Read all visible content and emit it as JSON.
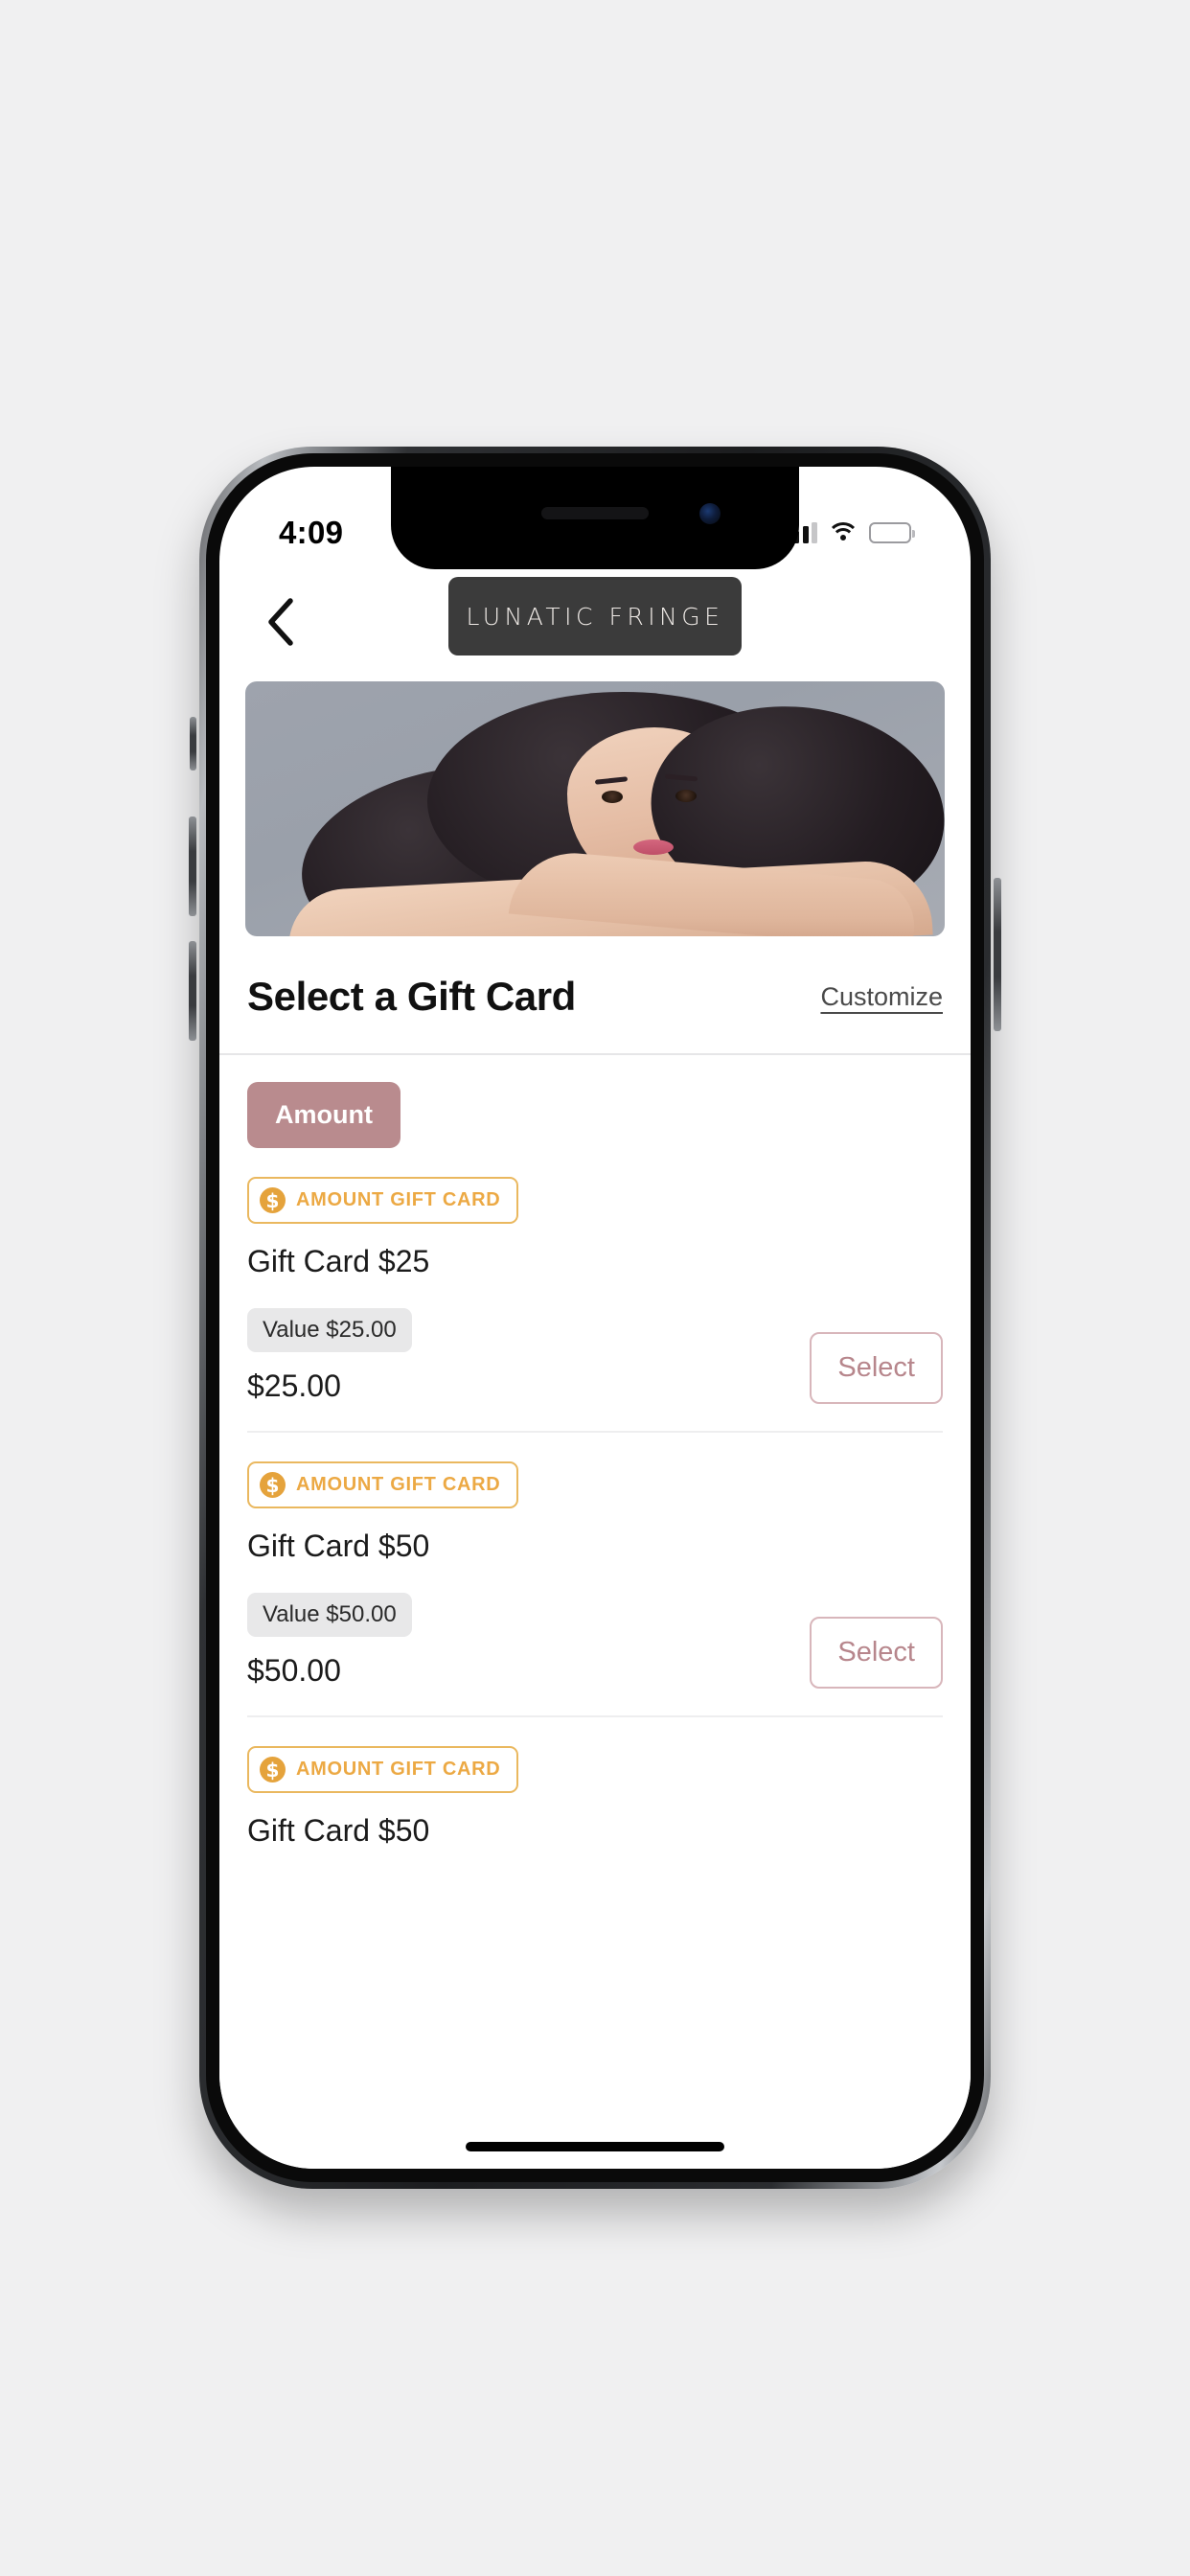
{
  "status_bar": {
    "time": "4:09",
    "signal_icon": "signal-bars-icon",
    "wifi_icon": "wifi-icon",
    "battery_icon": "battery-icon",
    "battery_color": "#ffcc00"
  },
  "header": {
    "back_icon": "chevron-left-icon",
    "brand": "LUNATIC FRINGE"
  },
  "hero": {
    "alt": "woman with long dark wavy hair salon hero image"
  },
  "section": {
    "title": "Select a Gift Card",
    "customize_label": "Customize"
  },
  "filters": {
    "amount_label": "Amount",
    "amount_color": "#b98b8e"
  },
  "gift_cards": [
    {
      "badge": "AMOUNT GIFT CARD",
      "badge_icon": "dollar-circle-icon",
      "name": "Gift Card $25",
      "value_label": "Value $25.00",
      "price": "$25.00",
      "select_label": "Select"
    },
    {
      "badge": "AMOUNT GIFT CARD",
      "badge_icon": "dollar-circle-icon",
      "name": "Gift Card $50",
      "value_label": "Value $50.00",
      "price": "$50.00",
      "select_label": "Select"
    },
    {
      "badge": "AMOUNT GIFT CARD",
      "badge_icon": "dollar-circle-icon",
      "name": "Gift Card $50",
      "value_label": "",
      "price": "",
      "select_label": ""
    }
  ],
  "colors": {
    "accent_rose": "#b98b8e",
    "accent_amber": "#e5a33c",
    "badge_border": "#eab85f",
    "select_border": "#d8b6bb",
    "logo_bg": "#3b3b3b"
  },
  "icons": {
    "dollar_glyph": "$",
    "home_indicator": "home-indicator"
  }
}
